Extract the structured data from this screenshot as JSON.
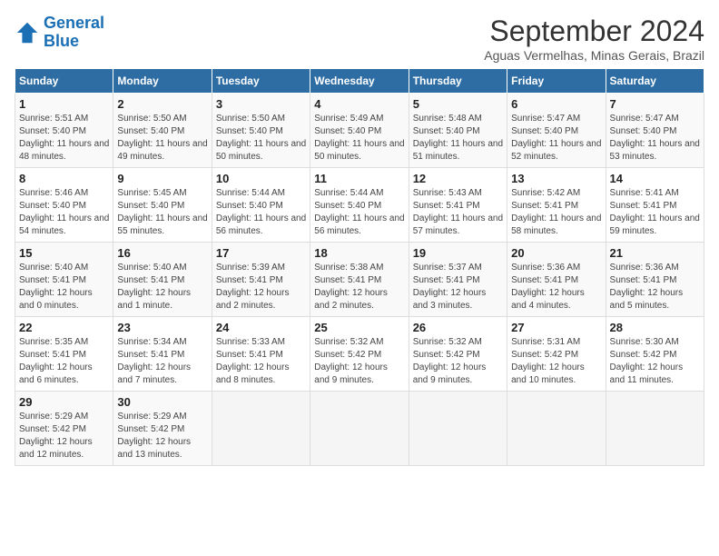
{
  "header": {
    "logo_line1": "General",
    "logo_line2": "Blue",
    "month": "September 2024",
    "location": "Aguas Vermelhas, Minas Gerais, Brazil"
  },
  "days_of_week": [
    "Sunday",
    "Monday",
    "Tuesday",
    "Wednesday",
    "Thursday",
    "Friday",
    "Saturday"
  ],
  "weeks": [
    [
      {
        "day": "1",
        "sunrise": "5:51 AM",
        "sunset": "5:40 PM",
        "daylight": "11 hours and 48 minutes."
      },
      {
        "day": "2",
        "sunrise": "5:50 AM",
        "sunset": "5:40 PM",
        "daylight": "11 hours and 49 minutes."
      },
      {
        "day": "3",
        "sunrise": "5:50 AM",
        "sunset": "5:40 PM",
        "daylight": "11 hours and 50 minutes."
      },
      {
        "day": "4",
        "sunrise": "5:49 AM",
        "sunset": "5:40 PM",
        "daylight": "11 hours and 50 minutes."
      },
      {
        "day": "5",
        "sunrise": "5:48 AM",
        "sunset": "5:40 PM",
        "daylight": "11 hours and 51 minutes."
      },
      {
        "day": "6",
        "sunrise": "5:47 AM",
        "sunset": "5:40 PM",
        "daylight": "11 hours and 52 minutes."
      },
      {
        "day": "7",
        "sunrise": "5:47 AM",
        "sunset": "5:40 PM",
        "daylight": "11 hours and 53 minutes."
      }
    ],
    [
      {
        "day": "8",
        "sunrise": "5:46 AM",
        "sunset": "5:40 PM",
        "daylight": "11 hours and 54 minutes."
      },
      {
        "day": "9",
        "sunrise": "5:45 AM",
        "sunset": "5:40 PM",
        "daylight": "11 hours and 55 minutes."
      },
      {
        "day": "10",
        "sunrise": "5:44 AM",
        "sunset": "5:40 PM",
        "daylight": "11 hours and 56 minutes."
      },
      {
        "day": "11",
        "sunrise": "5:44 AM",
        "sunset": "5:40 PM",
        "daylight": "11 hours and 56 minutes."
      },
      {
        "day": "12",
        "sunrise": "5:43 AM",
        "sunset": "5:41 PM",
        "daylight": "11 hours and 57 minutes."
      },
      {
        "day": "13",
        "sunrise": "5:42 AM",
        "sunset": "5:41 PM",
        "daylight": "11 hours and 58 minutes."
      },
      {
        "day": "14",
        "sunrise": "5:41 AM",
        "sunset": "5:41 PM",
        "daylight": "11 hours and 59 minutes."
      }
    ],
    [
      {
        "day": "15",
        "sunrise": "5:40 AM",
        "sunset": "5:41 PM",
        "daylight": "12 hours and 0 minutes."
      },
      {
        "day": "16",
        "sunrise": "5:40 AM",
        "sunset": "5:41 PM",
        "daylight": "12 hours and 1 minute."
      },
      {
        "day": "17",
        "sunrise": "5:39 AM",
        "sunset": "5:41 PM",
        "daylight": "12 hours and 2 minutes."
      },
      {
        "day": "18",
        "sunrise": "5:38 AM",
        "sunset": "5:41 PM",
        "daylight": "12 hours and 2 minutes."
      },
      {
        "day": "19",
        "sunrise": "5:37 AM",
        "sunset": "5:41 PM",
        "daylight": "12 hours and 3 minutes."
      },
      {
        "day": "20",
        "sunrise": "5:36 AM",
        "sunset": "5:41 PM",
        "daylight": "12 hours and 4 minutes."
      },
      {
        "day": "21",
        "sunrise": "5:36 AM",
        "sunset": "5:41 PM",
        "daylight": "12 hours and 5 minutes."
      }
    ],
    [
      {
        "day": "22",
        "sunrise": "5:35 AM",
        "sunset": "5:41 PM",
        "daylight": "12 hours and 6 minutes."
      },
      {
        "day": "23",
        "sunrise": "5:34 AM",
        "sunset": "5:41 PM",
        "daylight": "12 hours and 7 minutes."
      },
      {
        "day": "24",
        "sunrise": "5:33 AM",
        "sunset": "5:41 PM",
        "daylight": "12 hours and 8 minutes."
      },
      {
        "day": "25",
        "sunrise": "5:32 AM",
        "sunset": "5:42 PM",
        "daylight": "12 hours and 9 minutes."
      },
      {
        "day": "26",
        "sunrise": "5:32 AM",
        "sunset": "5:42 PM",
        "daylight": "12 hours and 9 minutes."
      },
      {
        "day": "27",
        "sunrise": "5:31 AM",
        "sunset": "5:42 PM",
        "daylight": "12 hours and 10 minutes."
      },
      {
        "day": "28",
        "sunrise": "5:30 AM",
        "sunset": "5:42 PM",
        "daylight": "12 hours and 11 minutes."
      }
    ],
    [
      {
        "day": "29",
        "sunrise": "5:29 AM",
        "sunset": "5:42 PM",
        "daylight": "12 hours and 12 minutes."
      },
      {
        "day": "30",
        "sunrise": "5:29 AM",
        "sunset": "5:42 PM",
        "daylight": "12 hours and 13 minutes."
      },
      null,
      null,
      null,
      null,
      null
    ]
  ]
}
